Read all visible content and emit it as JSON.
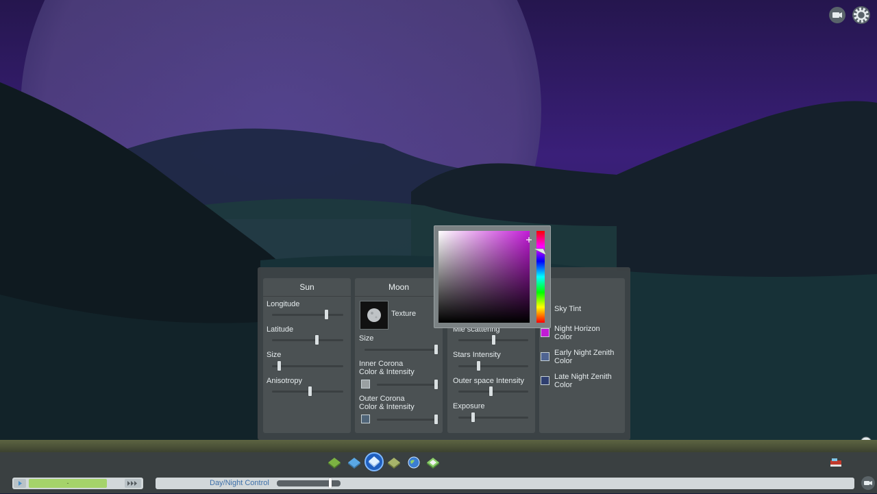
{
  "panel": {
    "sun": {
      "header": "Sun",
      "longitude_label": "Longitude",
      "latitude_label": "Latitude",
      "size_label": "Size",
      "anisotropy_label": "Anisotropy",
      "longitude_value": 0.78,
      "latitude_value": 0.64,
      "size_value": 0.08,
      "anisotropy_value": 0.54
    },
    "moon": {
      "header": "Moon",
      "texture_label": "Texture",
      "size_label": "Size",
      "inner_corona_label_1": "Inner Corona",
      "inner_corona_label_2": "Color & Intensity",
      "outer_corona_label_1": "Outer Corona",
      "outer_corona_label_2": "Color & Intensity",
      "size_value": 0.99,
      "inner_corona_value": 0.99,
      "outer_corona_value": 0.99,
      "inner_corona_color": "#9aa0a2",
      "outer_corona_color": "#4f6478"
    },
    "atmosphere": {
      "mie_label": "Mie scattering",
      "stars_label": "Stars Intensity",
      "outer_space_label": "Outer space Intensity",
      "exposure_label": "Exposure",
      "mie_value": 0.5,
      "stars_value": 0.28,
      "outer_space_value": 0.46,
      "exposure_value": 0.2
    },
    "colors": {
      "sky_tint_label": "Sky Tint",
      "night_horizon_1": "Night Horizon",
      "night_horizon_2": "Color",
      "early_night_1": "Early Night Zenith",
      "early_night_2": "Color",
      "late_night_1": "Late Night Zenith",
      "late_night_2": "Color",
      "night_horizon_color": "#c21bd6",
      "early_night_color": "#4f6492",
      "late_night_color": "#2f3f70"
    }
  },
  "picker": {
    "hue_color": "#c21bd6"
  },
  "toolbar": {
    "day_night_label": "Day/Night Control",
    "time_placeholder": "-",
    "day_night_value": 0.85
  },
  "icons": {
    "camera": "camera-icon",
    "settings": "gear-icon",
    "close": "close-icon"
  }
}
